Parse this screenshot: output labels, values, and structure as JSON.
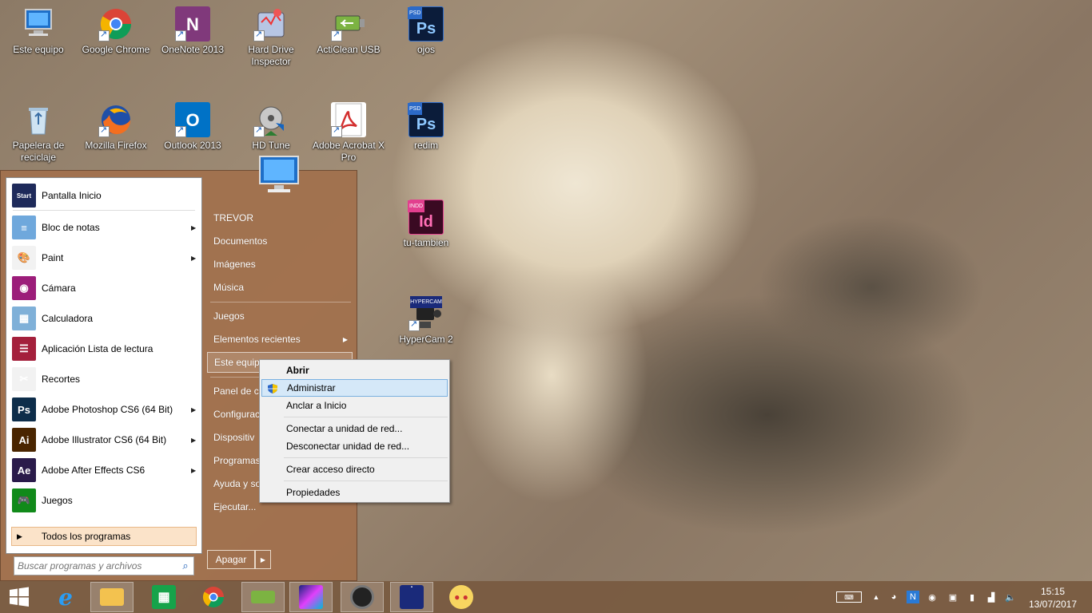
{
  "desktop": {
    "icons": [
      {
        "label_line1": "Este equipo",
        "label_line2": ""
      },
      {
        "label_line1": "Google Chrome",
        "label_line2": ""
      },
      {
        "label_line1": "OneNote 2013",
        "label_line2": ""
      },
      {
        "label_line1": "Hard Drive",
        "label_line2": "Inspector"
      },
      {
        "label_line1": "ActiClean USB",
        "label_line2": ""
      },
      {
        "label_line1": "ojos",
        "label_line2": ""
      },
      {
        "label_line1": "Papelera de",
        "label_line2": "reciclaje"
      },
      {
        "label_line1": "Mozilla Firefox",
        "label_line2": ""
      },
      {
        "label_line1": "Outlook 2013",
        "label_line2": ""
      },
      {
        "label_line1": "HD Tune",
        "label_line2": ""
      },
      {
        "label_line1": "Adobe Acrobat X",
        "label_line2": "Pro"
      },
      {
        "label_line1": "redim",
        "label_line2": ""
      },
      {
        "label_line1": "tu-tambien",
        "label_line2": ""
      },
      {
        "label_line1": "HyperCam 2",
        "label_line2": ""
      }
    ],
    "icon_glyphs": {
      "psd": "Ps",
      "indd": "Id",
      "onenote": "N",
      "outlook": "O"
    },
    "badges": {
      "psd": "PSD",
      "indd": "INDD",
      "hypercam": "HYPERCAM"
    }
  },
  "start_menu": {
    "pinned": [
      {
        "label": "Pantalla Inicio",
        "icon": "start-screen-icon",
        "glyph": "Start",
        "color": "#1e2a5a",
        "arrow": false
      },
      {
        "label": "Bloc de notas",
        "icon": "notepad-icon",
        "glyph": "≡",
        "color": "#6fa8dc",
        "arrow": true
      },
      {
        "label": "Paint",
        "icon": "paint-icon",
        "glyph": "🎨",
        "color": "#f2f2f2",
        "arrow": true
      },
      {
        "label": "Cámara",
        "icon": "camera-icon",
        "glyph": "◉",
        "color": "#9c1d7a",
        "arrow": false
      },
      {
        "label": "Calculadora",
        "icon": "calculator-icon",
        "glyph": "▦",
        "color": "#7fb0d8",
        "arrow": false
      },
      {
        "label": "Aplicación Lista de lectura",
        "icon": "reading-list-icon",
        "glyph": "☰",
        "color": "#a4203c",
        "arrow": false
      },
      {
        "label": "Recortes",
        "icon": "snipping-tool-icon",
        "glyph": "✂",
        "color": "#f2f2f2",
        "arrow": false
      },
      {
        "label": "Adobe Photoshop CS6 (64 Bit)",
        "icon": "photoshop-icon",
        "glyph": "Ps",
        "color": "#0d2d4a",
        "arrow": true
      },
      {
        "label": "Adobe Illustrator CS6 (64 Bit)",
        "icon": "illustrator-icon",
        "glyph": "Ai",
        "color": "#4a2500",
        "arrow": true
      },
      {
        "label": "Adobe After Effects CS6",
        "icon": "after-effects-icon",
        "glyph": "Ae",
        "color": "#2a1b4a",
        "arrow": true
      },
      {
        "label": "Juegos",
        "icon": "games-icon",
        "glyph": "🎮",
        "color": "#118a1a",
        "arrow": false
      }
    ],
    "all_programs": "Todos los programas",
    "search_placeholder": "Buscar programas y archivos",
    "right_pane": {
      "user": "TREVOR",
      "documents": "Documentos",
      "images": "Imágenes",
      "music": "Música",
      "games": "Juegos",
      "recent": "Elementos recientes",
      "computer": "Este equipo",
      "control_panel": "Panel de co",
      "settings": "Configurac",
      "devices": "Dispositiv",
      "programs": "Programas",
      "help": "Ayuda y so",
      "run": "Ejecutar..."
    },
    "shutdown": "Apagar"
  },
  "context_menu": {
    "open": "Abrir",
    "manage": "Administrar",
    "pin": "Anclar a Inicio",
    "map_drive": "Conectar a unidad de red...",
    "disconnect_drive": "Desconectar unidad de red...",
    "shortcut": "Crear acceso directo",
    "properties": "Propiedades"
  },
  "taskbar": {
    "time": "15:15",
    "date": "13/07/2017"
  },
  "colors": {
    "taskbar": "#785a40",
    "start_menu": "#a1704c",
    "highlight": "#d5e8f8"
  }
}
